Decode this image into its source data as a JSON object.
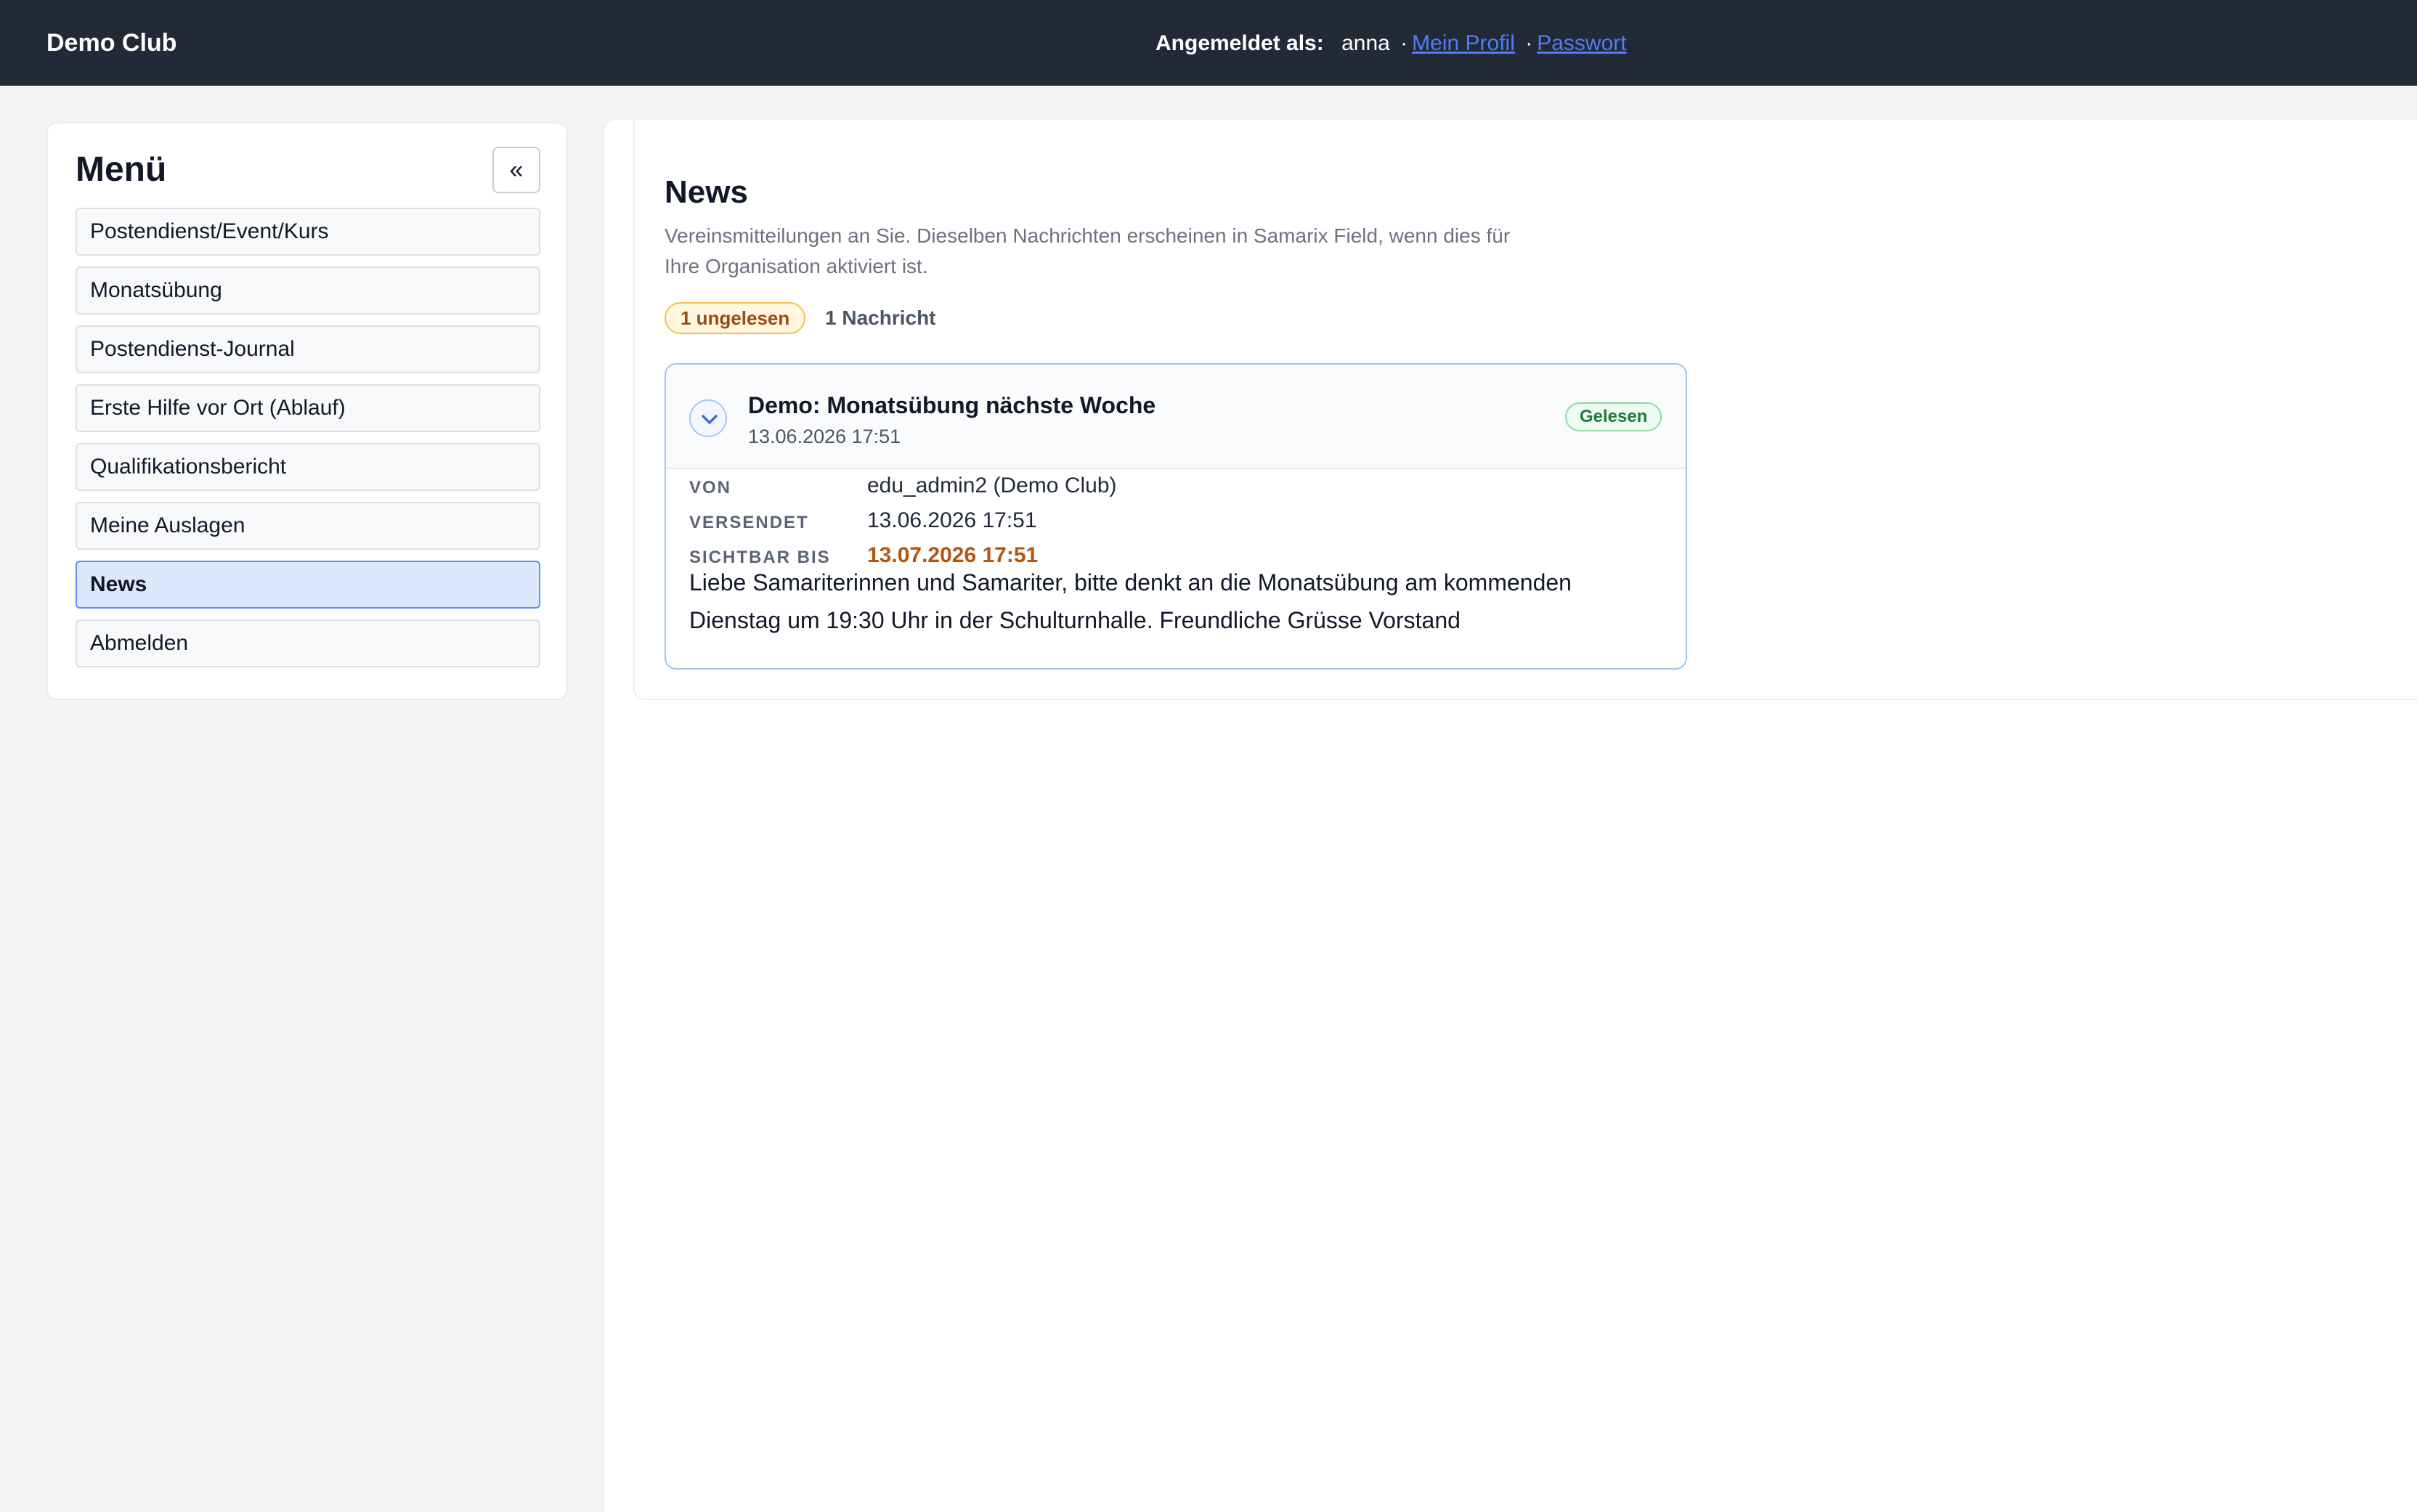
{
  "topbar": {
    "brand": "Demo Club",
    "logged_in_label": "Angemeldet als:",
    "username": "anna",
    "separator": "·",
    "profile_link": "Mein Profil",
    "password_link": "Passwort",
    "link_color": "#4f7cf7",
    "background": "#222a38"
  },
  "sidebar": {
    "title": "Menü",
    "collapse_label": "«",
    "items": [
      {
        "label": "Postendienst/Event/Kurs",
        "active": false
      },
      {
        "label": "Monatsübung",
        "active": false
      },
      {
        "label": "Postendienst-Journal",
        "active": false
      },
      {
        "label": "Erste Hilfe vor Ort (Ablauf)",
        "active": false
      },
      {
        "label": "Qualifikationsbericht",
        "active": false
      },
      {
        "label": "Meine Auslagen",
        "active": false
      },
      {
        "label": "News",
        "active": true
      },
      {
        "label": "Abmelden",
        "active": false
      }
    ]
  },
  "main": {
    "title": "News",
    "description": "Vereinsmitteilungen an Sie. Dieselben Nachrichten erscheinen in Samarix Field, wenn dies für Ihre Organisation aktiviert ist.",
    "unread_badge": "1 ungelesen",
    "message_count": "1 Nachricht",
    "news": [
      {
        "title": "Demo: Monatsübung nächste Woche",
        "date": "13.06.2026 17:51",
        "status": "Gelesen",
        "expand_icon": "chevron-down-icon",
        "meta": {
          "from_label": "VON",
          "from_value": "edu_admin2 (Demo Club)",
          "sent_label": "VERSENDET",
          "sent_value": "13.06.2026 17:51",
          "visible_label": "SICHTBAR BIS",
          "visible_value": "13.07.2026 17:51"
        },
        "body": "Liebe Samariterinnen und Samariter, bitte denkt an die Monatsübung am kommenden Dienstag um 19:30 Uhr in der Schulturnhalle. Freundliche Grüsse Vorstand"
      }
    ]
  },
  "colors": {
    "accent": "#5a8ff0",
    "unread_badge_text": "#9a4a12",
    "read_badge_text": "#237a3a",
    "visible_until_text": "#b65512"
  }
}
